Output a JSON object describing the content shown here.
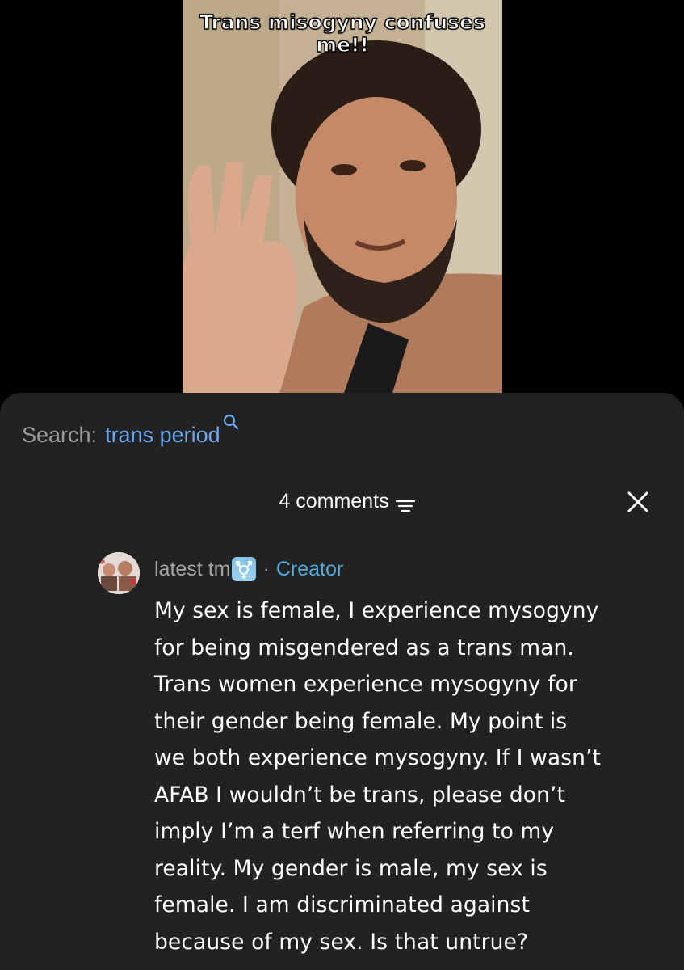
{
  "video": {
    "caption": "Trans misogyny confuses me!!"
  },
  "search": {
    "prefix": "Search:",
    "term": "trans period",
    "icon": "search-icon"
  },
  "comments_header": {
    "count_label": "4 comments",
    "filter_icon": "filter-icon",
    "close_icon": "close-icon"
  },
  "comment": {
    "username": "latest tm",
    "badge_icon": "transgender-symbol-icon",
    "separator": "·",
    "role": "Creator",
    "text": "My sex is female, I experience mysogyny\nfor being misgendered as a trans man.\nTrans women experience mysogyny for\ntheir gender being female. My point is\nwe both experience mysogyny. If I wasn’t\nAFAB I wouldn’t be trans, please don’t\nimply I’m a terf when referring to my\nreality. My gender is male, my sex is\nfemale. I am discriminated against\nbecause of my sex. Is that untrue?"
  },
  "colors": {
    "sheet_background": "#222222",
    "search_term": "#6aa9f5",
    "creator_label": "#52a8d6",
    "muted_text": "#a5a5a5"
  }
}
